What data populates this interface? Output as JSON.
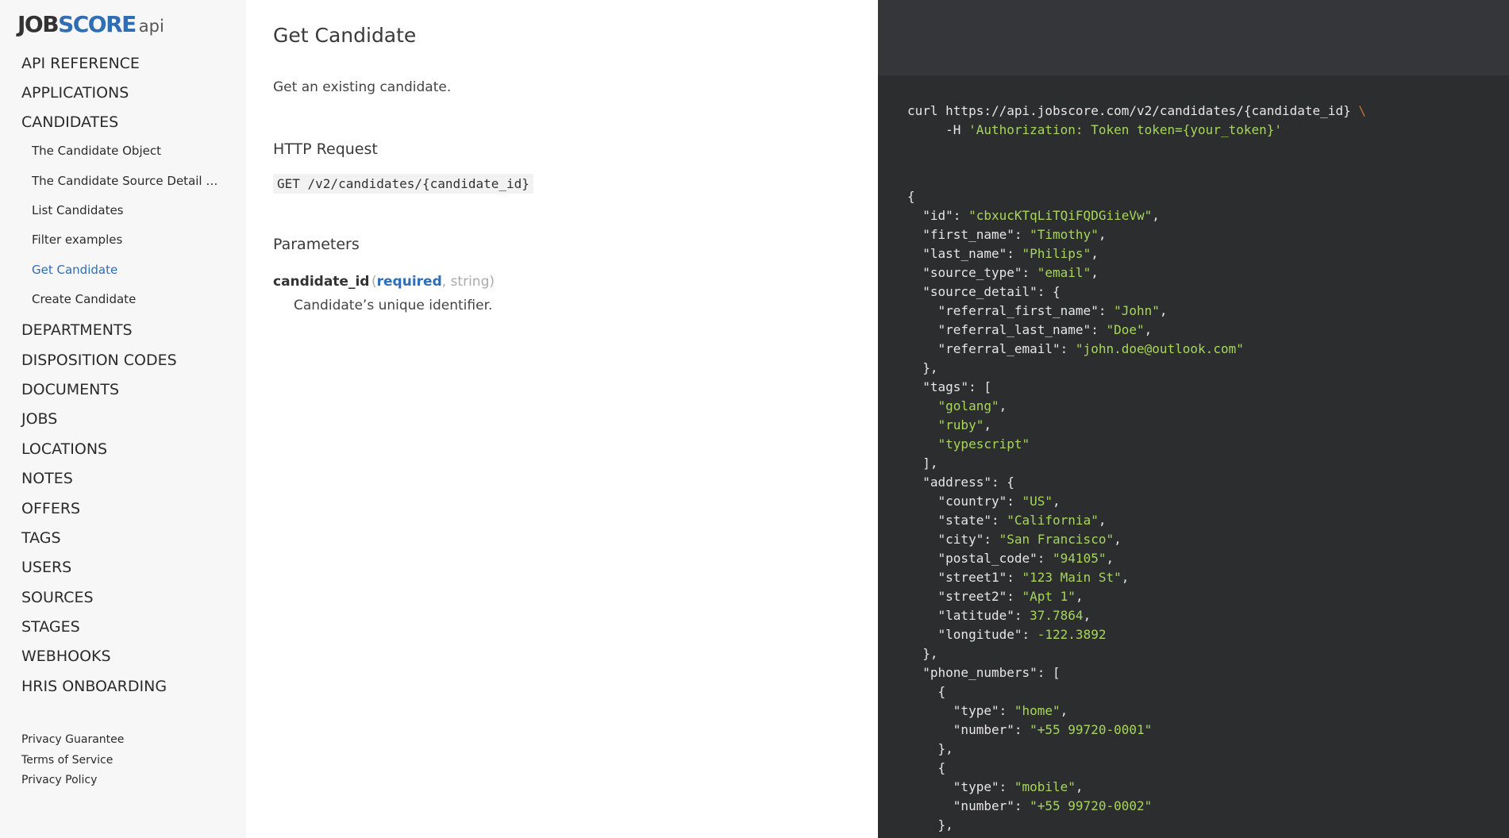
{
  "logo": {
    "part1": "JOB",
    "part2": "SCORE",
    "part3": "api"
  },
  "nav": [
    {
      "label": "API REFERENCE",
      "level": 1
    },
    {
      "label": "APPLICATIONS",
      "level": 1
    },
    {
      "label": "CANDIDATES",
      "level": 1
    },
    {
      "label": "The Candidate Object",
      "level": 2
    },
    {
      "label": "The Candidate Source Detail Ob...",
      "level": 2
    },
    {
      "label": "List Candidates",
      "level": 2
    },
    {
      "label": "Filter examples",
      "level": 2
    },
    {
      "label": "Get Candidate",
      "level": 2,
      "active": true
    },
    {
      "label": "Create Candidate",
      "level": 2
    },
    {
      "label": "DEPARTMENTS",
      "level": 1
    },
    {
      "label": "DISPOSITION CODES",
      "level": 1
    },
    {
      "label": "DOCUMENTS",
      "level": 1
    },
    {
      "label": "JOBS",
      "level": 1
    },
    {
      "label": "LOCATIONS",
      "level": 1
    },
    {
      "label": "NOTES",
      "level": 1
    },
    {
      "label": "OFFERS",
      "level": 1
    },
    {
      "label": "TAGS",
      "level": 1
    },
    {
      "label": "USERS",
      "level": 1
    },
    {
      "label": "SOURCES",
      "level": 1
    },
    {
      "label": "STAGES",
      "level": 1
    },
    {
      "label": "WEBHOOKS",
      "level": 1
    },
    {
      "label": "HRIS ONBOARDING",
      "level": 1
    }
  ],
  "footer": {
    "privacy_guarantee": "Privacy Guarantee",
    "terms": "Terms of Service",
    "privacy_policy": "Privacy Policy"
  },
  "main": {
    "title": "Get Candidate",
    "description": "Get an existing candidate.",
    "http_request_heading": "HTTP Request",
    "endpoint": "GET /v2/candidates/{candidate_id}",
    "parameters_heading": "Parameters",
    "param": {
      "name": "candidate_id",
      "open": "(",
      "required": "required",
      "type": ", string)",
      "description": "Candidate’s unique identifier."
    }
  },
  "code": {
    "curl_line1": "curl https://api.jobscore.com/v2/candidates/{candidate_id}",
    "curl_backslash": "\\",
    "curl_line2_prefix": "     -H ",
    "curl_line2_header": "'Authorization: Token token={your_token}'",
    "response_lines": [
      [
        [
          "p",
          "{"
        ]
      ],
      [
        [
          "p",
          "  \"id\": "
        ],
        [
          "s",
          "\"cbxucKTqLiTQiFQDGiieVw\""
        ],
        [
          "p",
          ","
        ]
      ],
      [
        [
          "p",
          "  \"first_name\": "
        ],
        [
          "s",
          "\"Timothy\""
        ],
        [
          "p",
          ","
        ]
      ],
      [
        [
          "p",
          "  \"last_name\": "
        ],
        [
          "s",
          "\"Philips\""
        ],
        [
          "p",
          ","
        ]
      ],
      [
        [
          "p",
          "  \"source_type\": "
        ],
        [
          "s",
          "\"email\""
        ],
        [
          "p",
          ","
        ]
      ],
      [
        [
          "p",
          "  \"source_detail\": {"
        ]
      ],
      [
        [
          "p",
          "    \"referral_first_name\": "
        ],
        [
          "s",
          "\"John\""
        ],
        [
          "p",
          ","
        ]
      ],
      [
        [
          "p",
          "    \"referral_last_name\": "
        ],
        [
          "s",
          "\"Doe\""
        ],
        [
          "p",
          ","
        ]
      ],
      [
        [
          "p",
          "    \"referral_email\": "
        ],
        [
          "s",
          "\"john.doe@outlook.com\""
        ]
      ],
      [
        [
          "p",
          "  },"
        ]
      ],
      [
        [
          "p",
          "  \"tags\": ["
        ]
      ],
      [
        [
          "p",
          "    "
        ],
        [
          "s",
          "\"golang\""
        ],
        [
          "p",
          ","
        ]
      ],
      [
        [
          "p",
          "    "
        ],
        [
          "s",
          "\"ruby\""
        ],
        [
          "p",
          ","
        ]
      ],
      [
        [
          "p",
          "    "
        ],
        [
          "s",
          "\"typescript\""
        ]
      ],
      [
        [
          "p",
          "  ],"
        ]
      ],
      [
        [
          "p",
          "  \"address\": {"
        ]
      ],
      [
        [
          "p",
          "    \"country\": "
        ],
        [
          "s",
          "\"US\""
        ],
        [
          "p",
          ","
        ]
      ],
      [
        [
          "p",
          "    \"state\": "
        ],
        [
          "s",
          "\"California\""
        ],
        [
          "p",
          ","
        ]
      ],
      [
        [
          "p",
          "    \"city\": "
        ],
        [
          "s",
          "\"San Francisco\""
        ],
        [
          "p",
          ","
        ]
      ],
      [
        [
          "p",
          "    \"postal_code\": "
        ],
        [
          "s",
          "\"94105\""
        ],
        [
          "p",
          ","
        ]
      ],
      [
        [
          "p",
          "    \"street1\": "
        ],
        [
          "s",
          "\"123 Main St\""
        ],
        [
          "p",
          ","
        ]
      ],
      [
        [
          "p",
          "    \"street2\": "
        ],
        [
          "s",
          "\"Apt 1\""
        ],
        [
          "p",
          ","
        ]
      ],
      [
        [
          "p",
          "    \"latitude\": "
        ],
        [
          "n",
          "37.7864"
        ],
        [
          "p",
          ","
        ]
      ],
      [
        [
          "p",
          "    \"longitude\": "
        ],
        [
          "n",
          "-122.3892"
        ]
      ],
      [
        [
          "p",
          "  },"
        ]
      ],
      [
        [
          "p",
          "  \"phone_numbers\": ["
        ]
      ],
      [
        [
          "p",
          "    {"
        ]
      ],
      [
        [
          "p",
          "      \"type\": "
        ],
        [
          "s",
          "\"home\""
        ],
        [
          "p",
          ","
        ]
      ],
      [
        [
          "p",
          "      \"number\": "
        ],
        [
          "s",
          "\"+55 99720-0001\""
        ]
      ],
      [
        [
          "p",
          "    },"
        ]
      ],
      [
        [
          "p",
          "    {"
        ]
      ],
      [
        [
          "p",
          "      \"type\": "
        ],
        [
          "s",
          "\"mobile\""
        ],
        [
          "p",
          ","
        ]
      ],
      [
        [
          "p",
          "      \"number\": "
        ],
        [
          "s",
          "\"+55 99720-0002\""
        ]
      ],
      [
        [
          "p",
          "    },"
        ]
      ]
    ]
  }
}
